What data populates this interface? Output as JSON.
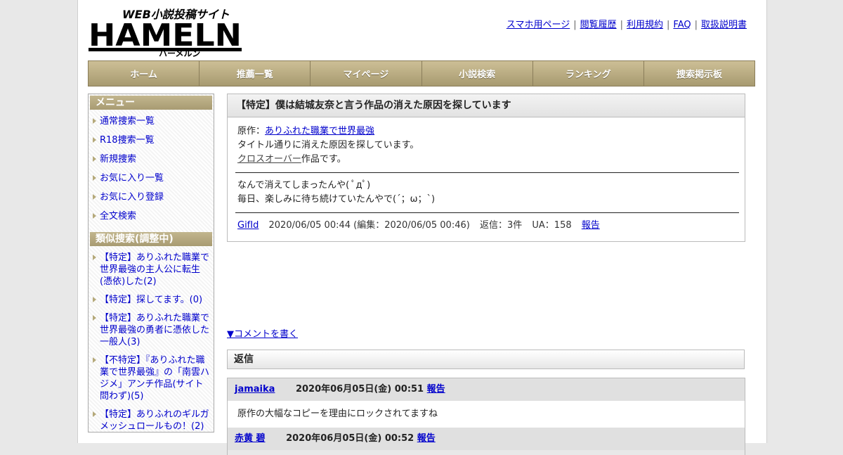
{
  "header": {
    "logo_title": "HAMELN",
    "logo_tagline": "WEB小説投稿サイト",
    "logo_kana": "ハーメルン",
    "links": [
      "スマホ用ページ",
      "閲覧履歴",
      "利用規約",
      "FAQ",
      "取扱説明書"
    ],
    "separator": "|"
  },
  "nav": [
    "ホーム",
    "推薦一覧",
    "マイページ",
    "小説検索",
    "ランキング",
    "捜索掲示板"
  ],
  "sidebar": {
    "menu_title": "メニュー",
    "menu_items": [
      "通常捜索一覧",
      "R18捜索一覧",
      "新規捜索",
      "お気に入り一覧",
      "お気に入り登録",
      "全文検索"
    ],
    "similar_title": "類似捜索(調整中)",
    "similar_items": [
      "【特定】ありふれた職業で世界最強の主人公に転生(憑依)した(2)",
      "【特定】探してます。(0)",
      "【特定】ありふれた職業で世界最強の勇者に憑依した一般人(3)",
      "【不特定】『ありふれた職業で世界最強』の「南雲ハジメ」アンチ作品(サイト問わず)(5)",
      "【特定】ありふれのギルガメッシュロールもの！(2)"
    ]
  },
  "post": {
    "title": "【特定】僕は結城友奈と言う作品の消えた原因を探しています",
    "original_label": "原作：",
    "original_link": "ありふれた職業で世界最強",
    "line2": "タイトル通りに消えた原因を探しています。",
    "crossover_link": "クロスオーバー",
    "line3_suffix": "作品です。",
    "body1": "なんで消えてしまったんや( ﾟдﾟ)",
    "body2": "毎日、楽しみに待ち続けていたんやで(´；ω；`)",
    "author": "GifId",
    "datetime": "2020/06/05 00:44 (編集：2020/06/05 00:46)",
    "replies": "返信：3件",
    "ua": "UA：158",
    "report": "報告"
  },
  "comment_link": "▼コメントを書く",
  "reply_section_title": "返信",
  "replies": [
    {
      "author": "jamaika",
      "datetime": "2020年06月05日(金) 00:51",
      "report": "報告",
      "body": "原作の大幅なコピーを理由にロックされてますね"
    },
    {
      "author": "赤黄 碧",
      "datetime": "2020年06月05日(金) 00:52",
      "report": "報告",
      "body": ""
    }
  ]
}
